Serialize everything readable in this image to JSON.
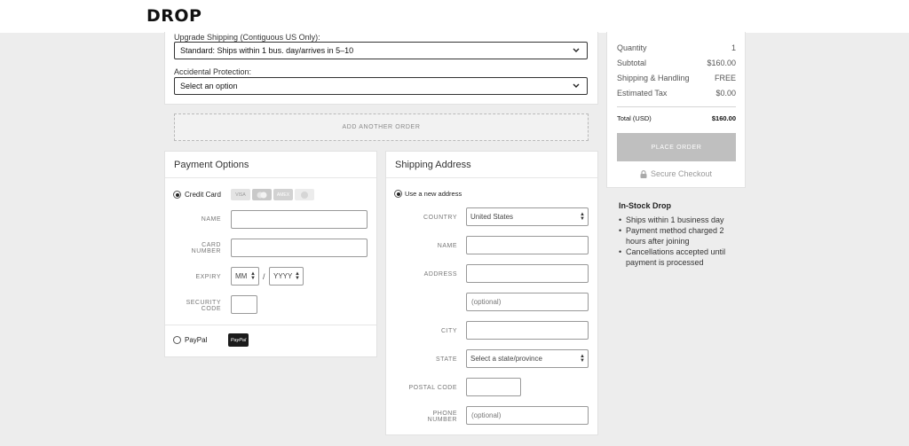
{
  "brand": {
    "logo": "DROP"
  },
  "order": {
    "upgrade_shipping_label": "Upgrade Shipping (Contiguous US Only):",
    "upgrade_shipping_value": "Standard: Ships within 1 bus. day/arrives in 5–10",
    "protection_label": "Accidental Protection:",
    "protection_value": "Select an option",
    "add_another": "ADD ANOTHER ORDER"
  },
  "payment": {
    "title": "Payment Options",
    "credit_card_label": "Credit Card",
    "card_icons": [
      "VISA",
      "",
      "AMEX",
      ""
    ],
    "name_label": "NAME",
    "card_number_label": "CARD NUMBER",
    "expiry_label": "EXPIRY",
    "expiry_month": "MM",
    "expiry_separator": "/",
    "expiry_year": "YYYY",
    "security_label": "SECURITY CODE",
    "paypal_label": "PayPal",
    "paypal_badge": "PayPal"
  },
  "shipping": {
    "title": "Shipping Address",
    "use_new": "Use a new address",
    "country_label": "COUNTRY",
    "country_value": "United States",
    "name_label": "NAME",
    "address_label": "ADDRESS",
    "address2_placeholder": "(optional)",
    "city_label": "CITY",
    "state_label": "STATE",
    "state_value": "Select a state/province",
    "postal_label": "POSTAL CODE",
    "phone_label": "PHONE NUMBER",
    "phone_placeholder": "(optional)"
  },
  "summary": {
    "rows": [
      {
        "label": "Quantity",
        "value": "1"
      },
      {
        "label": "Subtotal",
        "value": "$160.00"
      },
      {
        "label": "Shipping & Handling",
        "value": "FREE"
      },
      {
        "label": "Estimated Tax",
        "value": "$0.00"
      }
    ],
    "total_label": "Total (USD)",
    "total_value": "$160.00",
    "place_order": "PLACE ORDER",
    "secure": "Secure Checkout"
  },
  "instock": {
    "title": "In-Stock Drop",
    "items": [
      "Ships within 1 business day",
      "Payment method charged 2 hours after joining",
      "Cancellations accepted until payment is processed"
    ]
  },
  "colors": {
    "accent_dark": "#111111",
    "button_disabled": "#bfbfbf",
    "background": "#ededed"
  }
}
